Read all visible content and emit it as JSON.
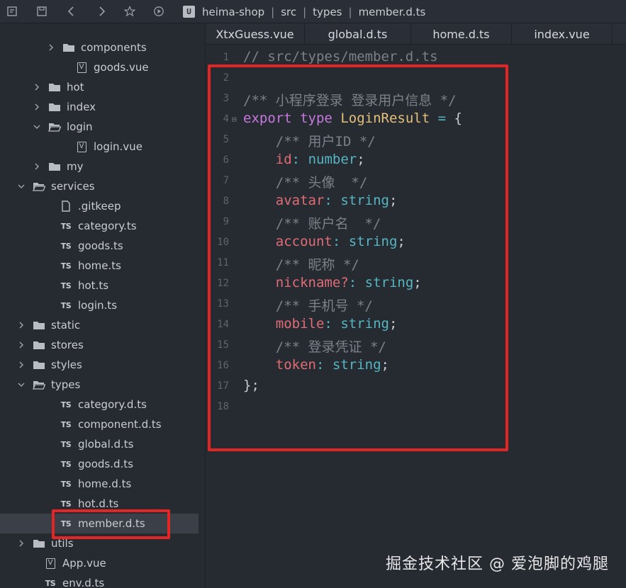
{
  "breadcrumb": {
    "project_badge": "U",
    "items": [
      "heima-shop",
      "src",
      "types",
      "member.d.ts"
    ]
  },
  "tabs": [
    "XtxGuess.vue",
    "global.d.ts",
    "home.d.ts",
    "index.vue"
  ],
  "tree": [
    {
      "label": "components",
      "kind": "folder",
      "expanded": false
    },
    {
      "label": "goods.vue",
      "kind": "vue"
    },
    {
      "label": "hot",
      "kind": "folder",
      "expanded": false
    },
    {
      "label": "index",
      "kind": "folder",
      "expanded": false
    },
    {
      "label": "login",
      "kind": "folder",
      "expanded": true
    },
    {
      "label": "login.vue",
      "kind": "vue"
    },
    {
      "label": "my",
      "kind": "folder",
      "expanded": false
    },
    {
      "label": "services",
      "kind": "folder",
      "expanded": true
    },
    {
      "label": ".gitkeep",
      "kind": "file"
    },
    {
      "label": "category.ts",
      "kind": "ts"
    },
    {
      "label": "goods.ts",
      "kind": "ts"
    },
    {
      "label": "home.ts",
      "kind": "ts"
    },
    {
      "label": "hot.ts",
      "kind": "ts"
    },
    {
      "label": "login.ts",
      "kind": "ts"
    },
    {
      "label": "static",
      "kind": "folder",
      "expanded": false
    },
    {
      "label": "stores",
      "kind": "folder",
      "expanded": false
    },
    {
      "label": "styles",
      "kind": "folder",
      "expanded": false
    },
    {
      "label": "types",
      "kind": "folder",
      "expanded": true
    },
    {
      "label": "category.d.ts",
      "kind": "ts"
    },
    {
      "label": "component.d.ts",
      "kind": "ts"
    },
    {
      "label": "global.d.ts",
      "kind": "ts"
    },
    {
      "label": "goods.d.ts",
      "kind": "ts"
    },
    {
      "label": "home.d.ts",
      "kind": "ts"
    },
    {
      "label": "hot.d.ts",
      "kind": "ts"
    },
    {
      "label": "member.d.ts",
      "kind": "ts",
      "selected": true
    },
    {
      "label": "utils",
      "kind": "folder",
      "expanded": false
    },
    {
      "label": "App.vue",
      "kind": "vue"
    },
    {
      "label": "env.d.ts",
      "kind": "ts"
    }
  ],
  "file_icon_labels": {
    "ts": "TS",
    "vue": "V"
  },
  "code": {
    "line_numbers": [
      "1",
      "2",
      "3",
      "4",
      "5",
      "6",
      "7",
      "8",
      "9",
      "10",
      "11",
      "12",
      "13",
      "14",
      "15",
      "16",
      "17",
      "18"
    ],
    "fold_marker": "⊟",
    "lines": [
      [
        [
          "comment",
          "// src/types/member.d.ts"
        ]
      ],
      [],
      [
        [
          "comment",
          "/** 小程序登录 登录用户信息 */"
        ]
      ],
      [
        [
          "kw",
          "export"
        ],
        [
          "punc",
          " "
        ],
        [
          "kw",
          "type"
        ],
        [
          "punc",
          " "
        ],
        [
          "type",
          "LoginResult"
        ],
        [
          "punc",
          " "
        ],
        [
          "op",
          "="
        ],
        [
          "punc",
          " {"
        ]
      ],
      [
        [
          "punc",
          "    "
        ],
        [
          "comment",
          "/** 用户ID */"
        ]
      ],
      [
        [
          "punc",
          "    "
        ],
        [
          "prop",
          "id"
        ],
        [
          "op",
          ":"
        ],
        [
          "punc",
          " "
        ],
        [
          "prim",
          "number"
        ],
        [
          "punc",
          ";"
        ]
      ],
      [
        [
          "punc",
          "    "
        ],
        [
          "comment",
          "/** 头像  */"
        ]
      ],
      [
        [
          "punc",
          "    "
        ],
        [
          "prop",
          "avatar"
        ],
        [
          "op",
          ":"
        ],
        [
          "punc",
          " "
        ],
        [
          "prim",
          "string"
        ],
        [
          "punc",
          ";"
        ]
      ],
      [
        [
          "punc",
          "    "
        ],
        [
          "comment",
          "/** 账户名  */"
        ]
      ],
      [
        [
          "punc",
          "    "
        ],
        [
          "prop",
          "account"
        ],
        [
          "op",
          ":"
        ],
        [
          "punc",
          " "
        ],
        [
          "prim",
          "string"
        ],
        [
          "punc",
          ";"
        ]
      ],
      [
        [
          "punc",
          "    "
        ],
        [
          "comment",
          "/** 昵称 */"
        ]
      ],
      [
        [
          "punc",
          "    "
        ],
        [
          "prop",
          "nickname?"
        ],
        [
          "op",
          ":"
        ],
        [
          "punc",
          " "
        ],
        [
          "prim",
          "string"
        ],
        [
          "punc",
          ";"
        ]
      ],
      [
        [
          "punc",
          "    "
        ],
        [
          "comment",
          "/** 手机号 */"
        ]
      ],
      [
        [
          "punc",
          "    "
        ],
        [
          "prop",
          "mobile"
        ],
        [
          "op",
          ":"
        ],
        [
          "punc",
          " "
        ],
        [
          "prim",
          "string"
        ],
        [
          "punc",
          ";"
        ]
      ],
      [
        [
          "punc",
          "    "
        ],
        [
          "comment",
          "/** 登录凭证 */"
        ]
      ],
      [
        [
          "punc",
          "    "
        ],
        [
          "prop",
          "token"
        ],
        [
          "op",
          ":"
        ],
        [
          "punc",
          " "
        ],
        [
          "prim",
          "string"
        ],
        [
          "punc",
          ";"
        ]
      ],
      [
        [
          "punc",
          "};"
        ]
      ],
      []
    ]
  },
  "watermark": "掘金技术社区 @ 爱泡脚的鸡腿",
  "colors": {
    "highlight": "#e32525",
    "selected_row": "#3b4048"
  }
}
